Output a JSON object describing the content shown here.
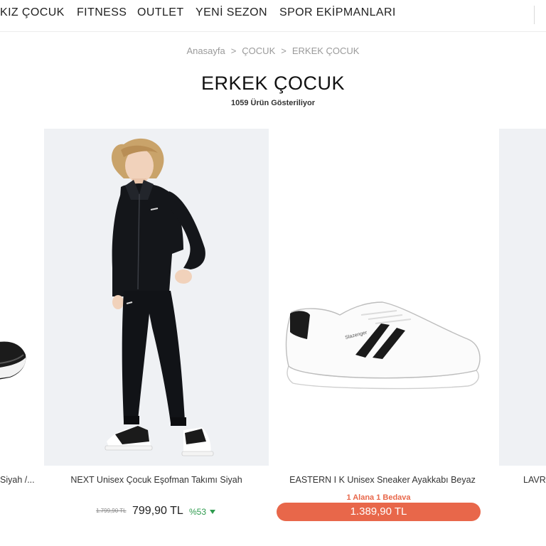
{
  "nav": {
    "items": [
      "KIZ ÇOCUK",
      "FITNESS",
      "OUTLET",
      "YENİ SEZON",
      "SPOR EKİPMANLARI"
    ]
  },
  "breadcrumb": {
    "items": [
      "Anasayfa",
      "ÇOCUK",
      "ERKEK ÇOCUK"
    ],
    "separator": ">"
  },
  "page": {
    "title": "ERKEK ÇOCUK",
    "result_count": "1059 Ürün Gösteriliyor"
  },
  "products": [
    {
      "name": "Siyah /..."
    },
    {
      "name": "NEXT Unisex Çocuk Eşofman Takımı Siyah",
      "old_price": "1.799,90 TL",
      "price": "799,90 TL",
      "discount": "%53"
    },
    {
      "name": "EASTERN I K Unisex Sneaker Ayakkabı Beyaz",
      "promo": "1 Alana 1 Bedava",
      "price": "1.389,90 TL",
      "logo_text": "Slazenger"
    },
    {
      "name": "LAVR"
    }
  ],
  "colors": {
    "accent": "#e8674a",
    "discount_green": "#2e9b4e",
    "image_bg": "#eff1f4"
  }
}
